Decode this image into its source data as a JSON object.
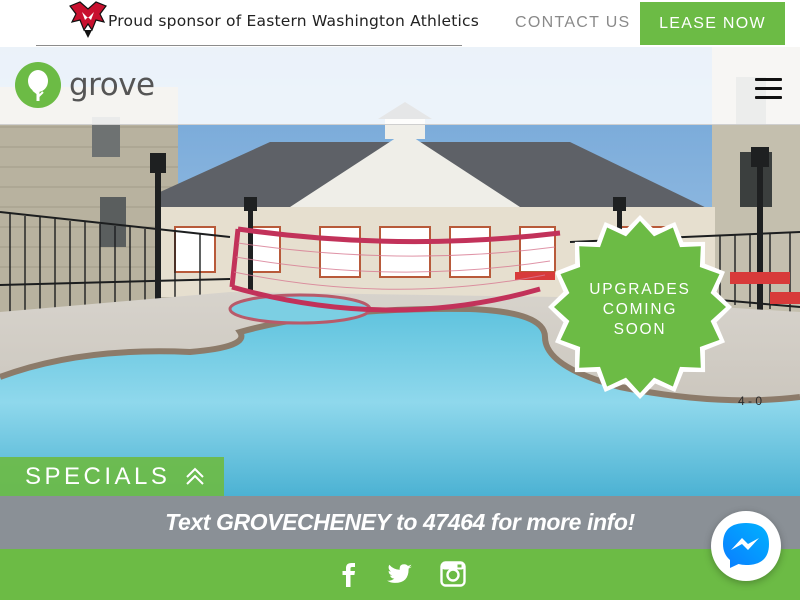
{
  "topbar": {
    "sponsor_text": "Proud sponsor of Eastern Washington Athletics",
    "contact_label": "CONTACT US",
    "lease_label": "LEASE NOW"
  },
  "brand": {
    "name": "grove",
    "logo_icon": "tree-in-circle-icon"
  },
  "hero": {
    "badge_lines": [
      "UPGRADES",
      "COMING",
      "SOON"
    ],
    "specials_label": "SPECIALS",
    "specials_icon": "double-chevron-up-icon",
    "menu_icon": "hamburger-icon"
  },
  "info": {
    "text": "Text GROVECHENEY to 47464 for more info!"
  },
  "social": {
    "facebook_icon": "facebook-icon",
    "twitter_icon": "twitter-icon",
    "instagram_icon": "instagram-icon"
  },
  "messenger": {
    "icon": "messenger-icon"
  },
  "colors": {
    "brand_green": "#6cbb45",
    "info_gray": "#8a9096",
    "eagle_red": "#c8102e"
  }
}
